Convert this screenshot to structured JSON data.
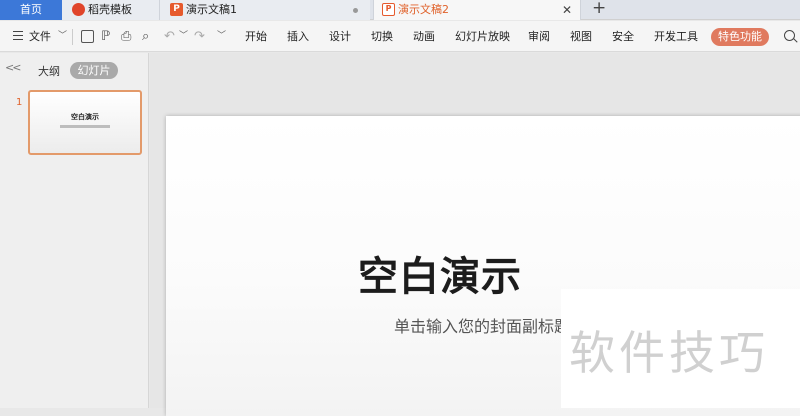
{
  "tabs": {
    "home": "首页",
    "template": "稻壳模板",
    "doc1": "演示文稿1",
    "doc2": "演示文稿2",
    "doc_icon_letter": "P"
  },
  "menu": {
    "file": "文件",
    "items": [
      "开始",
      "插入",
      "设计",
      "切换",
      "动画",
      "幻灯片放映",
      "审阅",
      "视图",
      "安全",
      "开发工具"
    ],
    "special": "特色功能"
  },
  "panel": {
    "outline_tab": "大纲",
    "slides_tab": "幻灯片",
    "slide_number": "1",
    "thumb_title": "空白演示"
  },
  "slide": {
    "title": "空白演示",
    "subtitle": "单击输入您的封面副标题"
  },
  "watermark": "软件技巧",
  "colors": {
    "accent": "#e0622b",
    "home_tab": "#3c78d8",
    "special_button": "#e07a5f"
  }
}
